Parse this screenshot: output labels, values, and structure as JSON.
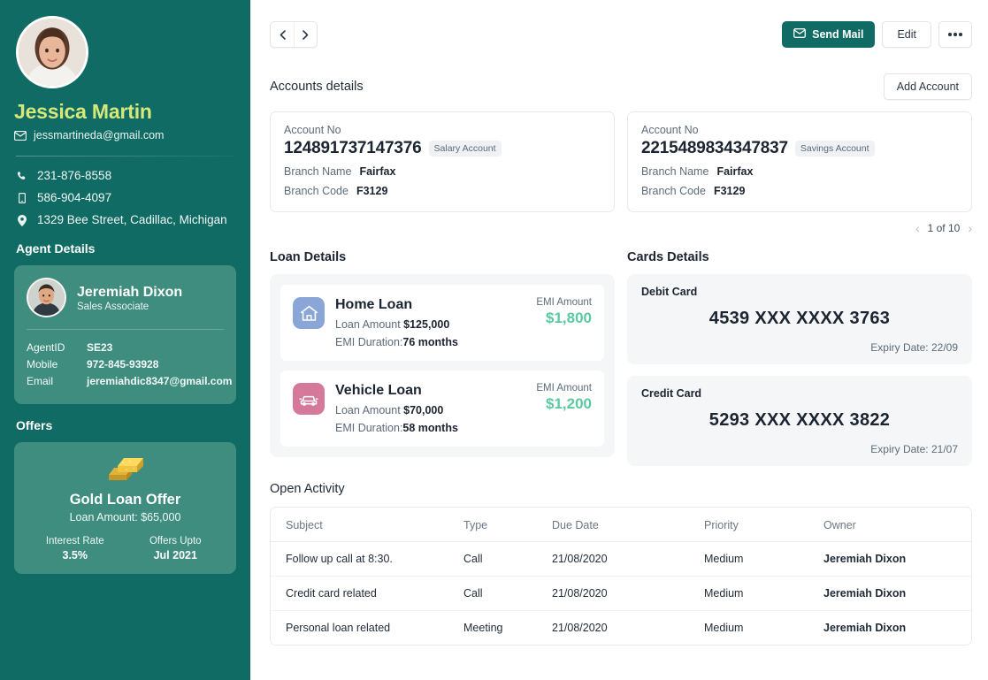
{
  "sidebar": {
    "profile": {
      "name": "Jessica Martin",
      "email": "jessmartineda@gmail.com",
      "phone": "231-876-8558",
      "mobile": "586-904-4097",
      "address": "1329  Bee Street, Cadillac, Michigan"
    },
    "agent_section_title": "Agent Details",
    "agent": {
      "name": "Jeremiah Dixon",
      "role": "Sales Associate",
      "fields": [
        {
          "key": "AgentID",
          "value": "SE23"
        },
        {
          "key": "Mobile",
          "value": "972-845-93928"
        },
        {
          "key": "Email",
          "value": "jeremiahdic8347@gmail.com"
        }
      ]
    },
    "offers_section_title": "Offers",
    "offer": {
      "icon": "gold-bars-icon",
      "title": "Gold Loan Offer",
      "subtitle": "Loan Amount: $65,000",
      "stats": [
        {
          "label": "Interest Rate",
          "value": "3.5%"
        },
        {
          "label": "Offers Upto",
          "value": "Jul 2021"
        }
      ]
    },
    "accent_bg": "#0f6b63",
    "card_bg": "#3f8d7f",
    "name_color": "#d6e87a"
  },
  "topbar": {
    "prev_label": "‹",
    "next_label": "›",
    "send_mail_label": "Send Mail",
    "edit_label": "Edit",
    "more_label": "more-options"
  },
  "accounts": {
    "section_title": "Accounts details",
    "add_button_label": "Add Account",
    "cards": [
      {
        "account_no_label": "Account No",
        "account_no": "124891737147376",
        "chip": "Salary Account",
        "branch_name_label": "Branch Name",
        "branch_name": "Fairfax",
        "branch_code_label": "Branch Code",
        "branch_code": "F3129"
      },
      {
        "account_no_label": "Account No",
        "account_no": "2215489834347837",
        "chip": "Savings Account",
        "branch_name_label": "Branch Name",
        "branch_name": "Fairfax",
        "branch_code_label": "Branch Code",
        "branch_code": "F3129"
      }
    ],
    "pager": {
      "prev": "‹",
      "text": "1 of 10",
      "next": "›"
    }
  },
  "loans": {
    "section_title": "Loan Details",
    "items": [
      {
        "icon": "home-icon",
        "icon_bg": "#8aa6d6",
        "name": "Home Loan",
        "amount_label": "Loan Amount",
        "amount": "$125,000",
        "duration_label": "EMI Duration:",
        "duration": "76 months",
        "emi_label": "EMI Amount",
        "emi_value": "$1,800"
      },
      {
        "icon": "car-icon",
        "icon_bg": "#d4799a",
        "name": "Vehicle Loan",
        "amount_label": "Loan Amount",
        "amount": "$70,000",
        "duration_label": "EMI Duration:",
        "duration": "58 months",
        "emi_label": "EMI Amount",
        "emi_value": "$1,200"
      }
    ]
  },
  "cards": {
    "section_title": "Cards Details",
    "items": [
      {
        "label": "Debit Card",
        "number": "4539 XXX XXXX 3763",
        "expiry": "Expiry Date: 22/09"
      },
      {
        "label": "Credit Card",
        "number": "5293 XXX XXXX 3822",
        "expiry": "Expiry Date: 21/07"
      }
    ]
  },
  "activity": {
    "section_title": "Open Activity",
    "columns": [
      "Subject",
      "Type",
      "Due Date",
      "Priority",
      "Owner"
    ],
    "rows": [
      {
        "subject": "Follow up call at 8:30.",
        "type": "Call",
        "due": "21/08/2020",
        "priority": "Medium",
        "owner": "Jeremiah Dixon"
      },
      {
        "subject": "Credit card related",
        "type": "Call",
        "due": "21/08/2020",
        "priority": "Medium",
        "owner": "Jeremiah Dixon"
      },
      {
        "subject": "Personal loan related",
        "type": "Meeting",
        "due": "21/08/2020",
        "priority": "Medium",
        "owner": "Jeremiah Dixon"
      }
    ]
  }
}
